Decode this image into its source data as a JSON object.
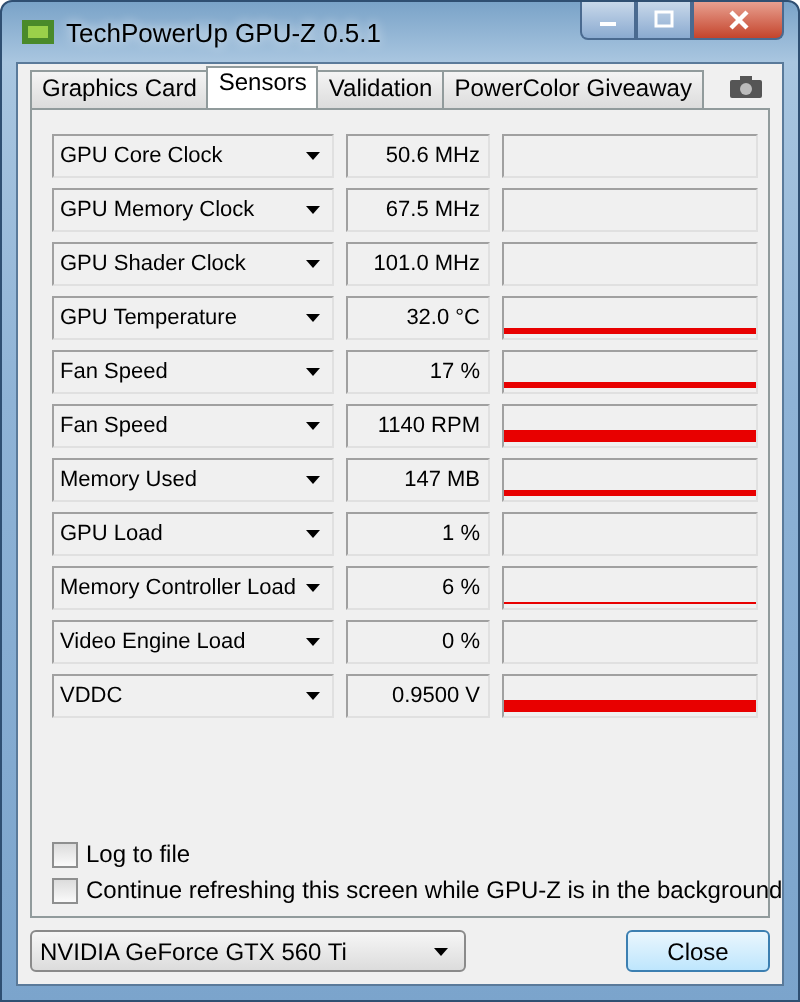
{
  "window": {
    "title": "TechPowerUp GPU-Z 0.5.1"
  },
  "tabs": [
    {
      "label": "Graphics Card",
      "selected": false
    },
    {
      "label": "Sensors",
      "selected": true
    },
    {
      "label": "Validation",
      "selected": false
    },
    {
      "label": "PowerColor Giveaway",
      "selected": false
    }
  ],
  "sensors": [
    {
      "name": "GPU Core Clock",
      "value": "50.6 MHz",
      "kind": "empty"
    },
    {
      "name": "GPU Memory Clock",
      "value": "67.5 MHz",
      "kind": "empty"
    },
    {
      "name": "GPU Shader Clock",
      "value": "101.0 MHz",
      "kind": "empty"
    },
    {
      "name": "GPU Temperature",
      "value": "32.0 °C",
      "kind": "thin"
    },
    {
      "name": "Fan Speed",
      "value": "17 %",
      "kind": "thin"
    },
    {
      "name": "Fan Speed",
      "value": "1140 RPM",
      "kind": "thick"
    },
    {
      "name": "Memory Used",
      "value": "147 MB",
      "kind": "thin"
    },
    {
      "name": "GPU Load",
      "value": "1 %",
      "kind": "empty"
    },
    {
      "name": "Memory Controller Load",
      "value": "6 %",
      "kind": "hairline"
    },
    {
      "name": "Video Engine Load",
      "value": "0 %",
      "kind": "empty"
    },
    {
      "name": "VDDC",
      "value": "0.9500 V",
      "kind": "thick"
    }
  ],
  "options": [
    {
      "label": "Log to file",
      "checked": false
    },
    {
      "label": "Continue refreshing this screen while GPU-Z is in the background",
      "checked": false
    }
  ],
  "gpu_select": {
    "value": "NVIDIA GeForce GTX 560 Ti"
  },
  "close_button": {
    "label": "Close"
  }
}
